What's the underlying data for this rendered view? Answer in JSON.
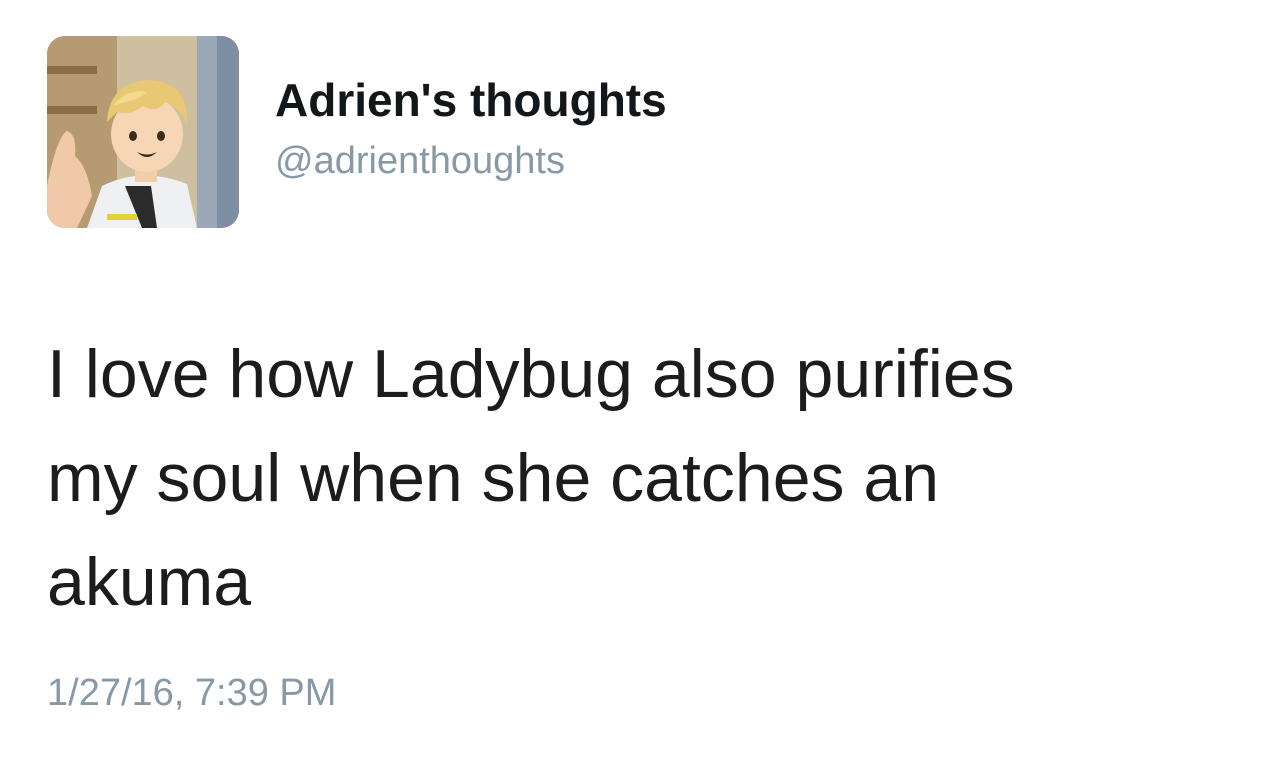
{
  "author": {
    "display_name": "Adrien's thoughts",
    "handle": "@adrienthoughts",
    "avatar_icon": "avatar-image"
  },
  "tweet": {
    "text_lines": [
      "I love how Ladybug also purifies",
      "my soul when she catches an",
      "akuma"
    ],
    "timestamp": "1/27/16, 7:39 PM"
  },
  "colors": {
    "name": "#14171a",
    "secondary": "#8899a6",
    "body_text": "#1c1c1c",
    "background": "#ffffff"
  }
}
